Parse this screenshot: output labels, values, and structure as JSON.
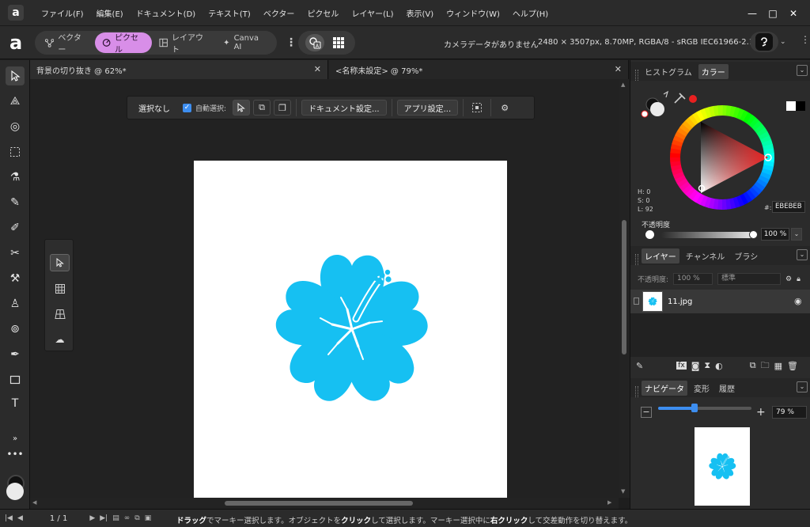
{
  "app": {
    "logo_letter": "a"
  },
  "menu": [
    "ファイル(F)",
    "編集(E)",
    "ドキュメント(D)",
    "テキスト(T)",
    "ベクター",
    "ピクセル",
    "レイヤー(L)",
    "表示(V)",
    "ウィンドウ(W)",
    "ヘルプ(H)"
  ],
  "window_buttons": [
    "—",
    "□",
    "✕"
  ],
  "personas": [
    {
      "label": "ベクター",
      "active": false
    },
    {
      "label": "ピクセル",
      "active": true
    },
    {
      "label": "レイアウト",
      "active": false
    },
    {
      "label": "Canva AI",
      "active": false
    }
  ],
  "doc_status": {
    "camera": "カメラデータがありません",
    "info": "2480 × 3507px, 8.70MP, RGBA/8 - sRGB IEC61966-2.1"
  },
  "tabs": [
    {
      "label": "背景の切り抜き @ 62%*"
    },
    {
      "label": "<名称未設定> @ 79%*"
    }
  ],
  "context": {
    "selection": "選択なし",
    "auto_select": "自動選択:",
    "doc_settings": "ドキュメント設定...",
    "app_settings": "アプリ設定..."
  },
  "color_panel": {
    "tabs": [
      "ヒストグラム",
      "カラー"
    ],
    "h": "H: 0",
    "s": "S: 0",
    "l": "L: 92",
    "hex_label": "#:",
    "hex": "EBEBEB",
    "opacity_label": "不透明度",
    "opacity": "100 %",
    "accent": "#e82020"
  },
  "layers_panel": {
    "tabs": [
      "レイヤー",
      "チャンネル",
      "ブラシ"
    ],
    "opacity_label": "不透明度:",
    "opacity": "100 %",
    "blend": "標準",
    "layer_name": "11.jpg"
  },
  "navigator": {
    "tabs": [
      "ナビゲータ",
      "変形",
      "履歴"
    ],
    "zoom": "79 %",
    "zoom_fraction": 0.39
  },
  "status": {
    "page": "1 / 1",
    "message_parts": [
      {
        "text": "ドラッグ",
        "bold": true
      },
      {
        "text": "でマーキー選択します。オブジェクトを",
        "bold": false
      },
      {
        "text": "クリック",
        "bold": true
      },
      {
        "text": "して選択します。マーキー選択中に",
        "bold": false
      },
      {
        "text": "右クリック",
        "bold": true
      },
      {
        "text": "して交差動作を切り替えます。",
        "bold": false
      }
    ]
  },
  "hibiscus_color": "#16c0f2"
}
